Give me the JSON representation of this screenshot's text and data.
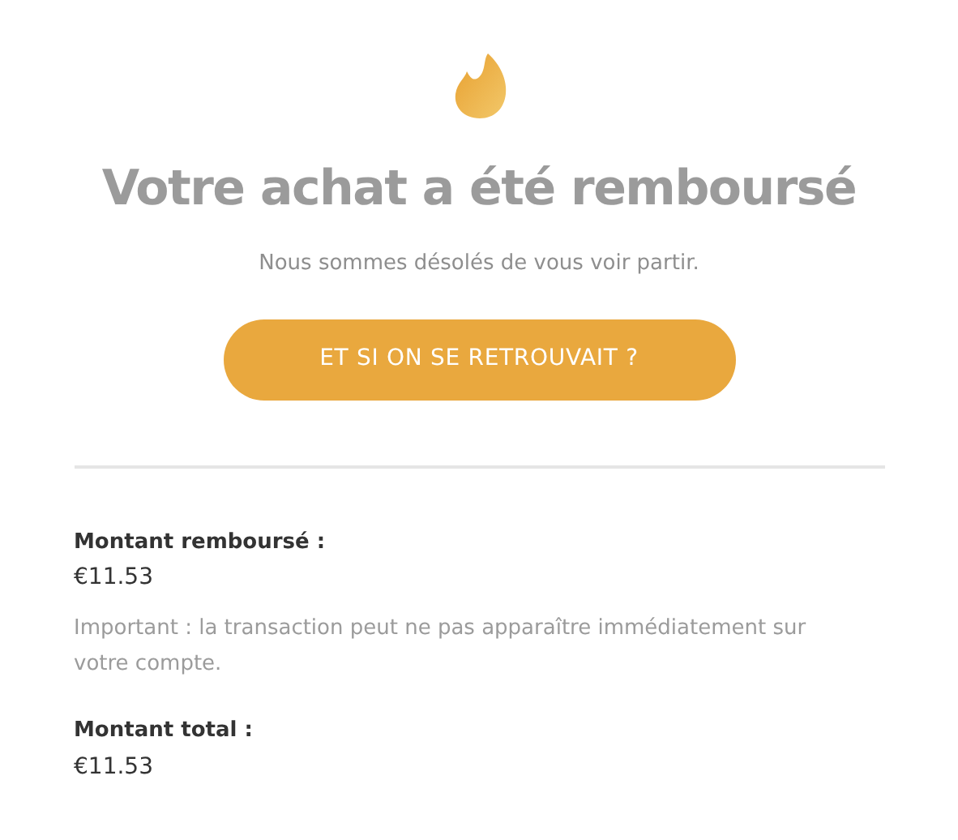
{
  "title": "Votre achat a été remboursé",
  "subtitle": "Nous sommes désolés de vous voir partir.",
  "button": "ET SI ON SE RETROUVAIT ?",
  "sections": [
    {
      "label": "Montant remboursé :",
      "value": "€11.53",
      "note": "Important : la transaction peut ne pas apparaître immédiatement sur votre compte."
    },
    {
      "label": "Montant total :",
      "value": "€11.53"
    }
  ]
}
